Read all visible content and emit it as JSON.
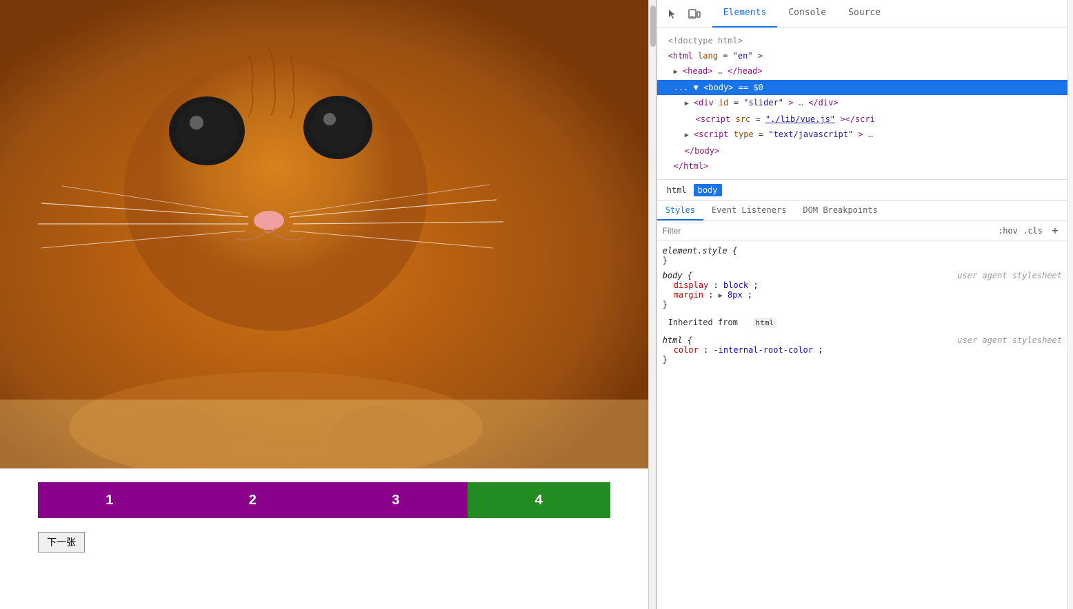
{
  "browser": {
    "slider_buttons": [
      {
        "label": "1",
        "color": "purple"
      },
      {
        "label": "2",
        "color": "purple"
      },
      {
        "label": "3",
        "color": "purple"
      },
      {
        "label": "4",
        "color": "green"
      }
    ],
    "next_button_label": "下一张"
  },
  "devtools": {
    "tabs": [
      {
        "label": "Elements",
        "active": true
      },
      {
        "label": "Console",
        "active": false
      },
      {
        "label": "Source",
        "active": false
      }
    ],
    "dom": {
      "lines": [
        {
          "text": "<!doctype html>",
          "indent": 0,
          "type": "comment"
        },
        {
          "indent": 0,
          "type": "tag",
          "open": "<html lang=\"en\">"
        },
        {
          "indent": 1,
          "type": "collapsed",
          "text": "▶ <head>…</head>"
        },
        {
          "indent": 1,
          "type": "selected",
          "text": "... ▼ <body> == $0"
        },
        {
          "indent": 2,
          "type": "tag",
          "text": "▶ <div id=\"slider\">…</div>"
        },
        {
          "indent": 3,
          "type": "tag",
          "text": "<script src=\"./lib/vue.js\"></scri"
        },
        {
          "indent": 2,
          "type": "tag",
          "text": "▶ <script type=\"text/javascript\">…"
        },
        {
          "indent": 2,
          "type": "tag",
          "text": "</body>"
        },
        {
          "indent": 1,
          "type": "tag",
          "text": "</html>"
        }
      ]
    },
    "breadcrumb": {
      "items": [
        {
          "label": "html",
          "active": false
        },
        {
          "label": "body",
          "active": true
        }
      ]
    },
    "styles_tabs": [
      {
        "label": "Styles",
        "active": true
      },
      {
        "label": "Event Listeners",
        "active": false
      },
      {
        "label": "DOM Breakpoints",
        "active": false
      }
    ],
    "filter_placeholder": "Filter",
    "filter_pseudo": ":hov  .cls",
    "filter_plus": "+",
    "css_rules": [
      {
        "selector": "element.style {",
        "props": [],
        "close": "}",
        "comment": ""
      },
      {
        "selector": "body {",
        "comment": "user agent stylesheet",
        "props": [
          {
            "name": "display",
            "value": "block",
            "colon": ":",
            "semicolon": ";"
          },
          {
            "name": "margin",
            "value": "▶ 8px",
            "colon": ":",
            "semicolon": ";"
          }
        ],
        "close": "}"
      }
    ],
    "inherited_label": "Inherited from",
    "inherited_tag": "html",
    "inherited_rules": [
      {
        "selector": "html {",
        "comment": "user agent stylesheet",
        "props": [
          {
            "name": "color",
            "value": "-internal-root-color",
            "colon": ":",
            "semicolon": ";"
          }
        ],
        "close": "}"
      }
    ]
  }
}
